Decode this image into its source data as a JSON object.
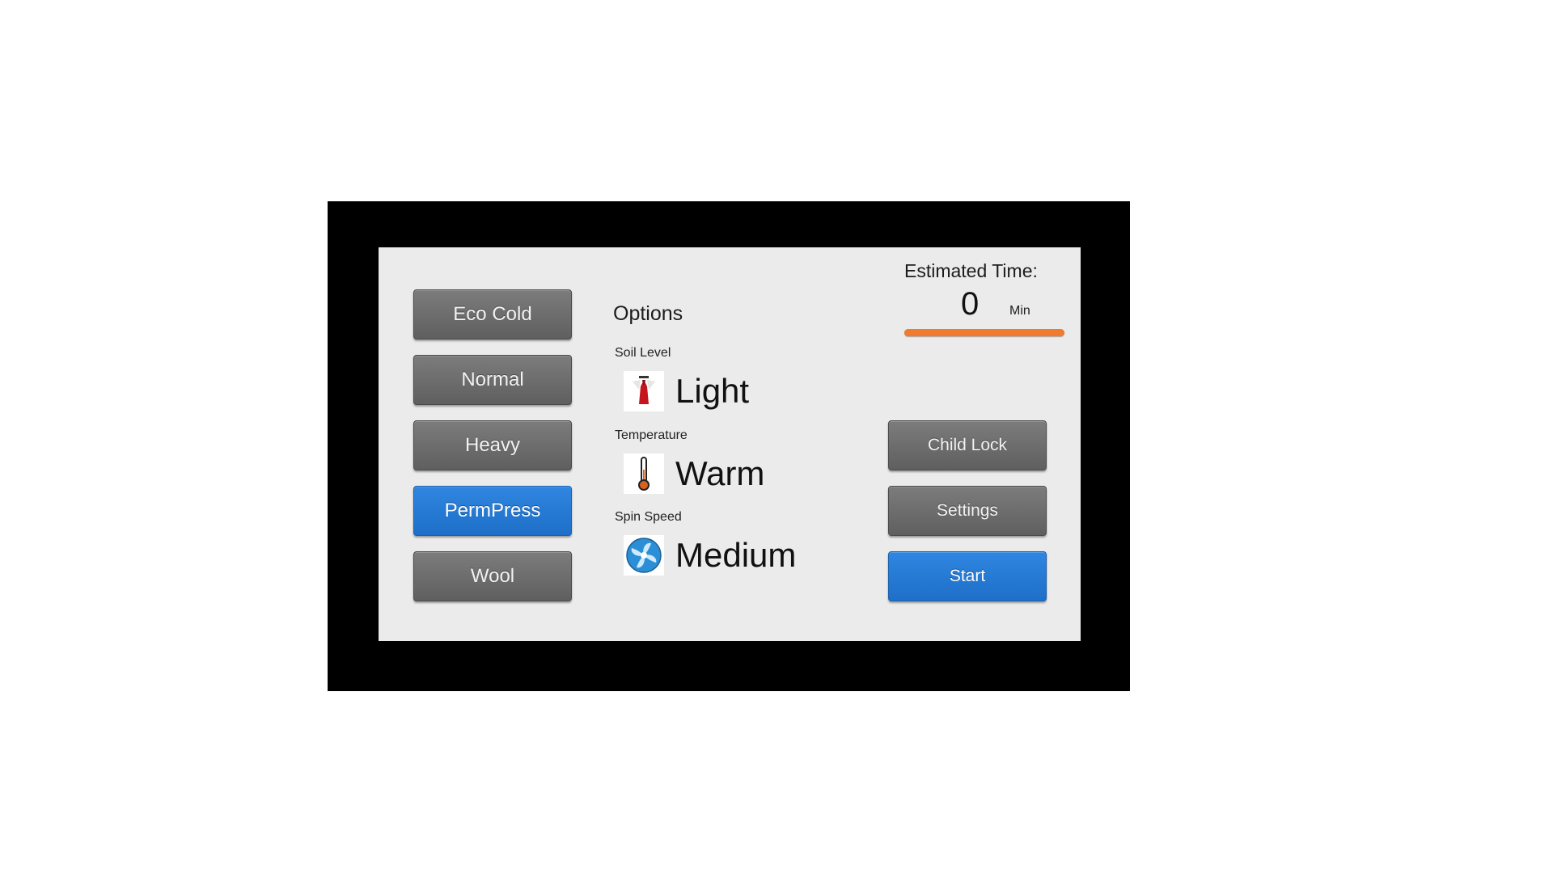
{
  "cycles": [
    {
      "label": "Eco Cold",
      "selected": false
    },
    {
      "label": "Normal",
      "selected": false
    },
    {
      "label": "Heavy",
      "selected": false
    },
    {
      "label": "PermPress",
      "selected": true
    },
    {
      "label": "Wool",
      "selected": false
    }
  ],
  "options": {
    "title": "Options",
    "soil_level": {
      "label": "Soil Level",
      "value": "Light",
      "icon": "shirt-icon"
    },
    "temperature": {
      "label": "Temperature",
      "value": "Warm",
      "icon": "thermometer-icon"
    },
    "spin_speed": {
      "label": "Spin Speed",
      "value": "Medium",
      "icon": "fan-icon"
    }
  },
  "estimate": {
    "label": "Estimated Time:",
    "value": "0",
    "unit": "Min"
  },
  "controls": {
    "child_lock": "Child Lock",
    "settings": "Settings",
    "start": "Start"
  },
  "colors": {
    "accent_blue": "#2f86e0",
    "button_gray": "#6e6e6e",
    "progress_orange": "#f07a2e",
    "screen_bg": "#ebebeb"
  }
}
